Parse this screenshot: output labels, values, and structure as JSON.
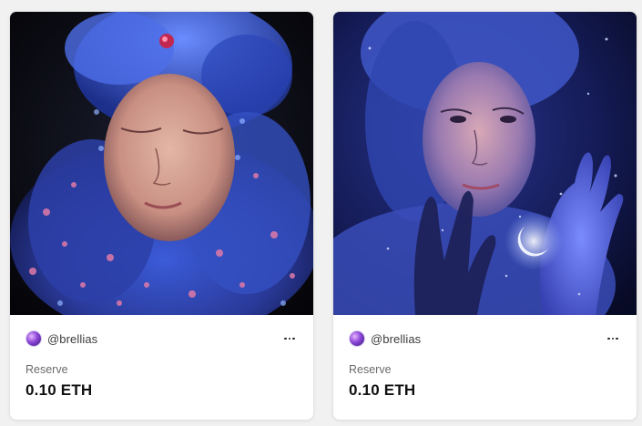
{
  "cards": [
    {
      "artwork_name": "artwork-flower-portrait",
      "creator_handle": "@brellias",
      "reserve_label": "Reserve",
      "reserve_value": "0.10 ETH",
      "more_icon": "more-horizontal-icon"
    },
    {
      "artwork_name": "artwork-moon-hands-portrait",
      "creator_handle": "@brellias",
      "reserve_label": "Reserve",
      "reserve_value": "0.10 ETH",
      "more_icon": "more-horizontal-icon"
    }
  ],
  "colors": {
    "page_background": "#f1f1f1",
    "card_background": "#ffffff",
    "art_left_bg": "#0a0b14",
    "art_left_hair": "#3a5fd0",
    "art_right_bg": "#1a1f5c",
    "art_right_glow": "#5a6cff"
  }
}
